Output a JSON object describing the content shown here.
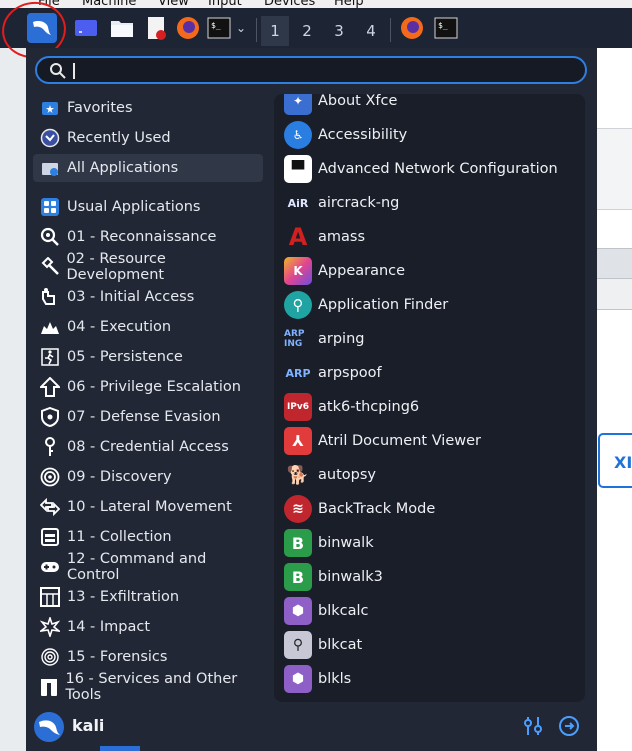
{
  "vbox_menu": [
    "File",
    "Machine",
    "View",
    "Input",
    "Devices",
    "Help"
  ],
  "taskbar": {
    "workspaces": [
      "1",
      "2",
      "3",
      "4"
    ],
    "icons": [
      "kali-menu-icon",
      "desktop-icon",
      "file-manager-icon",
      "text-editor-icon",
      "firefox-icon",
      "terminal-icon",
      "firefox-icon",
      "terminal-icon"
    ]
  },
  "search": {
    "value": "",
    "placeholder": ""
  },
  "categories": [
    {
      "label": "Favorites",
      "icon": "star-icon"
    },
    {
      "label": "Recently Used",
      "icon": "clock-icon"
    },
    {
      "label": "All Applications",
      "icon": "all-apps-icon"
    },
    {
      "label": "Usual Applications",
      "icon": "grid-icon"
    },
    {
      "label": "01 - Reconnaissance",
      "icon": "magnifier-icon"
    },
    {
      "label": "02 - Resource Development",
      "icon": "hammer-icon"
    },
    {
      "label": "03 - Initial Access",
      "icon": "key-hand-icon"
    },
    {
      "label": "04 - Execution",
      "icon": "explosion-icon"
    },
    {
      "label": "05 - Persistence",
      "icon": "runner-icon"
    },
    {
      "label": "06 - Privilege Escalation",
      "icon": "arrow-up-icon"
    },
    {
      "label": "07 - Defense Evasion",
      "icon": "shield-icon"
    },
    {
      "label": "08 - Credential Access",
      "icon": "key-icon"
    },
    {
      "label": "09 - Discovery",
      "icon": "radar-icon"
    },
    {
      "label": "10 - Lateral Movement",
      "icon": "lateral-arrows-icon"
    },
    {
      "label": "11 - Collection",
      "icon": "box-icon"
    },
    {
      "label": "12 - Command and Control",
      "icon": "gamepad-icon"
    },
    {
      "label": "13 - Exfiltration",
      "icon": "exfil-icon"
    },
    {
      "label": "14 - Impact",
      "icon": "impact-icon"
    },
    {
      "label": "15 - Forensics",
      "icon": "fingerprint-icon"
    },
    {
      "label": "16 - Services and Other Tools",
      "icon": "tools-icon"
    }
  ],
  "apps": [
    {
      "label": "About Xfce",
      "icon": "xfce-icon",
      "color": "#3a6fd1"
    },
    {
      "label": "Accessibility",
      "icon": "accessibility-icon",
      "color": "#2a7de1"
    },
    {
      "label": "Advanced Network Configuration",
      "icon": "network-icon",
      "color": "#ffffff"
    },
    {
      "label": "aircrack-ng",
      "icon": "aircrack-icon",
      "color": "#1a1e29"
    },
    {
      "label": "amass",
      "icon": "amass-icon",
      "color": "#d22020"
    },
    {
      "label": "Appearance",
      "icon": "appearance-icon",
      "color": "#f0b429"
    },
    {
      "label": "Application Finder",
      "icon": "app-finder-icon",
      "color": "#1fa3a3"
    },
    {
      "label": "arping",
      "icon": "arping-icon",
      "color": "#1a1e29"
    },
    {
      "label": "arpspoof",
      "icon": "arpspoof-icon",
      "color": "#1a1e29"
    },
    {
      "label": "atk6-thcping6",
      "icon": "atk6-icon",
      "color": "#c0262d"
    },
    {
      "label": "Atril Document Viewer",
      "icon": "pdf-icon",
      "color": "#e23b3b"
    },
    {
      "label": "autopsy",
      "icon": "autopsy-icon",
      "color": "#1a1e29"
    },
    {
      "label": "BackTrack Mode",
      "icon": "backtrack-icon",
      "color": "#c0262d"
    },
    {
      "label": "binwalk",
      "icon": "binwalk-icon",
      "color": "#2a9c4a"
    },
    {
      "label": "binwalk3",
      "icon": "binwalk-icon",
      "color": "#2a9c4a"
    },
    {
      "label": "blkcalc",
      "icon": "sleuthkit-icon",
      "color": "#8e5fc7"
    },
    {
      "label": "blkcat",
      "icon": "sleuthkit-icon",
      "color": "#c7c7d6"
    },
    {
      "label": "blkls",
      "icon": "sleuthkit-icon",
      "color": "#8e5fc7"
    }
  ],
  "user": {
    "name": "kali"
  },
  "colors": {
    "accent": "#2d7fe0",
    "menu_bg": "#222735",
    "apps_bg": "#1a1e29"
  }
}
